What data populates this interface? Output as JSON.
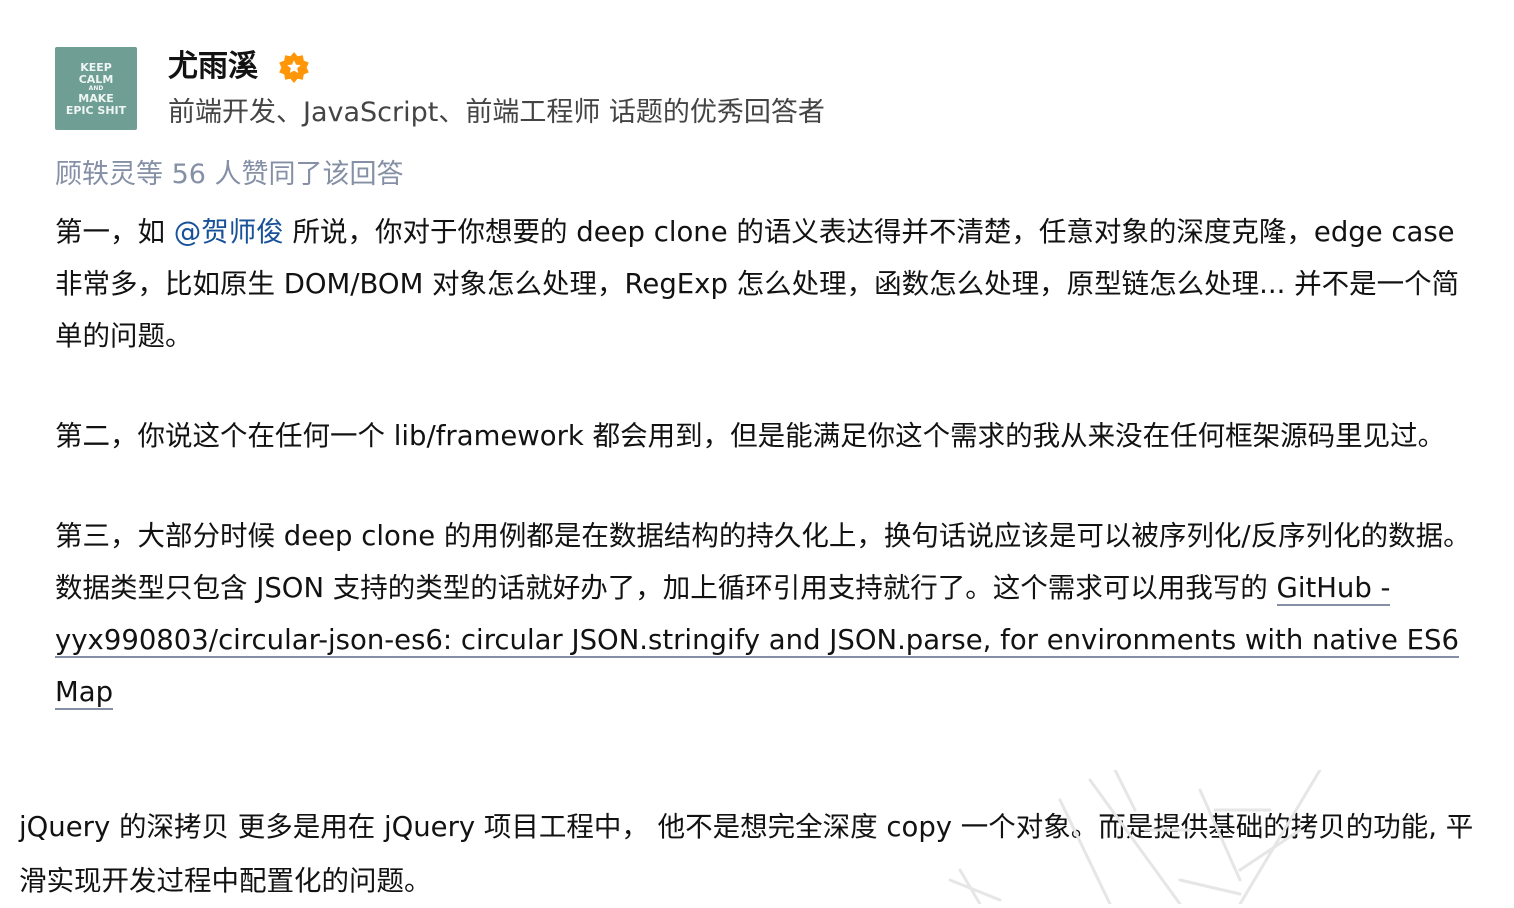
{
  "author": {
    "name": "尤雨溪",
    "badge_icon": "certified-badge-icon",
    "headline": "前端开发、JavaScript、前端工程师 话题的优秀回答者",
    "avatar_lines": [
      "KEEP",
      "CALM",
      "AND",
      "MAKE",
      "EPIC SHIT"
    ]
  },
  "votes_text": "顾轶灵等 56 人赞同了该回答",
  "answer": {
    "p1_prefix": "第一，如 ",
    "p1_mention": "@贺师俊",
    "p1_suffix": " 所说，你对于你想要的 deep clone 的语义表达得并不清楚，任意对象的深度克隆，edge case 非常多，比如原生 DOM/BOM 对象怎么处理，RegExp 怎么处理，函数怎么处理，原型链怎么处理... 并不是一个简单的问题。",
    "p2": "第二，你说这个在任何一个 lib/framework 都会用到，但是能满足你这个需求的我从来没在任何框架源码里见过。",
    "p3_prefix": "第三，大部分时候 deep clone 的用例都是在数据结构的持久化上，换句话说应该是可以被序列化/反序列化的数据。数据类型只包含 JSON 支持的类型的话就好办了，加上循环引用支持就行了。这个需求可以用我写的 ",
    "p3_link": "GitHub - yyx990803/circular-json-es6: circular JSON.stringify and JSON.parse, for environments with native ES6 Map"
  },
  "note": "jQuery 的深拷贝 更多是用在 jQuery 项目工程中，  他不是想完全深度 copy 一个对象。而是提供基础的拷贝的功能, 平滑实现开发过程中配置化的问题。",
  "colors": {
    "mention": "#175199",
    "muted": "#8590a6",
    "badge": "#ff9607",
    "avatar_bg": "#6f9e94"
  }
}
